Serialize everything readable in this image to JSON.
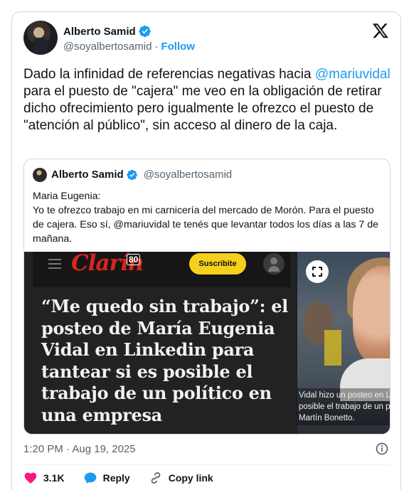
{
  "author": {
    "name": "Alberto Samid",
    "handle": "@soyalbertosamid",
    "separator": "·",
    "follow_label": "Follow"
  },
  "tweet": {
    "text_before": "Dado la infinidad de referencias negativas hacia ",
    "mention": "@mariuvidal",
    "text_after": " para el puesto de \"cajera\" me veo en la obligación de retirar dicho ofrecimiento pero igualmente le ofrezco el puesto de \"atención al público\", sin acceso al dinero de la caja.",
    "timestamp": "1:20 PM · Aug 19, 2025"
  },
  "quote": {
    "name": "Alberto Samid",
    "handle": "@soyalbertosamid",
    "line1": "Maria Eugenia:",
    "line2": "Yo te ofrezco trabajo en mi carnicería del mercado de Morón. Para el puesto de cajera. Eso sí,  @mariuvidal te tenés que levantar todos los días a las 7 de mañana."
  },
  "media": {
    "brand": "Clarín",
    "brand_badge": "80",
    "subscribe_label": "Suscribite",
    "headline": "“Me quedo sin trabajo”: el posteo de María Eugenia Vidal en Linkedin para tantear si es posible el trabajo de un político en una empresa",
    "caption_lines": [
      "Vidal hizo un posteo en Li",
      "posible el trabajo de un p",
      "Martín Bonetto."
    ]
  },
  "actions": {
    "likes": "3.1K",
    "reply_label": "Reply",
    "copy_link_label": "Copy link"
  },
  "colors": {
    "accent": "#1d9bf0",
    "like": "#f91880",
    "clarin_red": "#d7261e",
    "subscribe_yellow": "#f5d01c"
  },
  "icons": [
    "verified-badge-icon",
    "x-logo-icon",
    "expand-icon",
    "info-icon",
    "heart-icon",
    "reply-icon",
    "link-icon",
    "hamburger-icon",
    "user-icon"
  ]
}
